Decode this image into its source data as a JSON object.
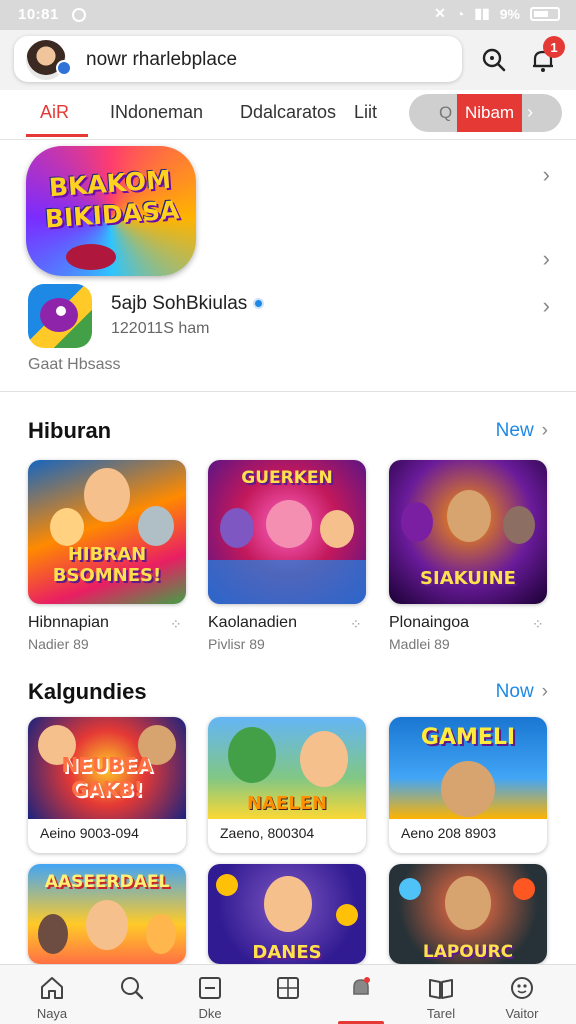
{
  "status_bar": {
    "time": "10:81",
    "battery": "9%"
  },
  "search": {
    "text": "nowr rharlebplace"
  },
  "notifications": {
    "badge": "1"
  },
  "tabs": [
    {
      "label": "AiR",
      "active": true
    },
    {
      "label": "INdoneman"
    },
    {
      "label": "Ddalcaratos"
    },
    {
      "label": "Liit"
    }
  ],
  "tab_pill": {
    "prefix": "Q",
    "label": "Nibam",
    "chevron": "›"
  },
  "featured": {
    "banner_line1": "BKAKOM",
    "banner_line2": "BIKIDASA",
    "app_name": "5ajb SohBkiulas",
    "app_sub": "122011S ham",
    "footer": "Gaat Hbsass"
  },
  "section1": {
    "title": "Hiburan",
    "link": "New",
    "games": [
      {
        "art_title": "HIBRAN BSOMNES!",
        "name": "Hibnnapian",
        "meta": "Nadier 89"
      },
      {
        "art_title": "GUERKEN",
        "name": "Kaolanadien",
        "meta": "Pivlisr 89"
      },
      {
        "art_title": "SIAKUINE",
        "name": "Plonaingoa",
        "meta": "Madlei 89"
      }
    ]
  },
  "section2": {
    "title": "Kalgundies",
    "link": "Now",
    "games": [
      {
        "art_title": "NEUBEA GAKB!",
        "caption": "Aeino 9003-094"
      },
      {
        "art_title": "NAELEN",
        "caption": "Zaeno, 800304"
      },
      {
        "art_title": "GAMELI",
        "caption": "Aeno 208 8903"
      }
    ],
    "games_row2": [
      {
        "art_title": "AASEERDAEL"
      },
      {
        "art_title": "DANES"
      },
      {
        "art_title": "LAPOURC"
      }
    ]
  },
  "bottom_nav": [
    {
      "label": "Naya",
      "icon": "home-icon"
    },
    {
      "label": "",
      "icon": "search-icon"
    },
    {
      "label": "Dke",
      "icon": "document-icon"
    },
    {
      "label": "",
      "icon": "grid-icon"
    },
    {
      "label": "",
      "icon": "bell-icon",
      "active": true
    },
    {
      "label": "Tarel",
      "icon": "book-icon"
    },
    {
      "label": "Vaitor",
      "icon": "profile-icon"
    }
  ],
  "colors": {
    "accent": "#e53935",
    "link": "#1e88e5"
  }
}
